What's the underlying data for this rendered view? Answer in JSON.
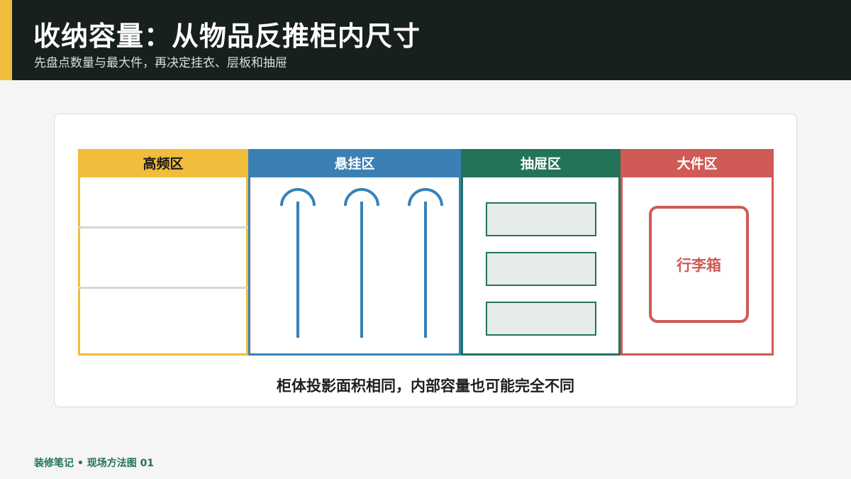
{
  "header": {
    "title": "收纳容量：从物品反推柜内尺寸",
    "subtitle": "先盘点数量与最大件，再决定挂衣、层板和抽屉"
  },
  "zones": [
    {
      "label": "高频区",
      "color": "#f0bd3c"
    },
    {
      "label": "悬挂区",
      "color": "#3a80b5"
    },
    {
      "label": "抽屉区",
      "color": "#23735a"
    },
    {
      "label": "大件区",
      "color": "#cf5a56"
    }
  ],
  "luggage_label": "行李箱",
  "caption": "柜体投影面积相同，内部容量也可能完全不同",
  "footer": "装修笔记 • 现场方法图 01"
}
